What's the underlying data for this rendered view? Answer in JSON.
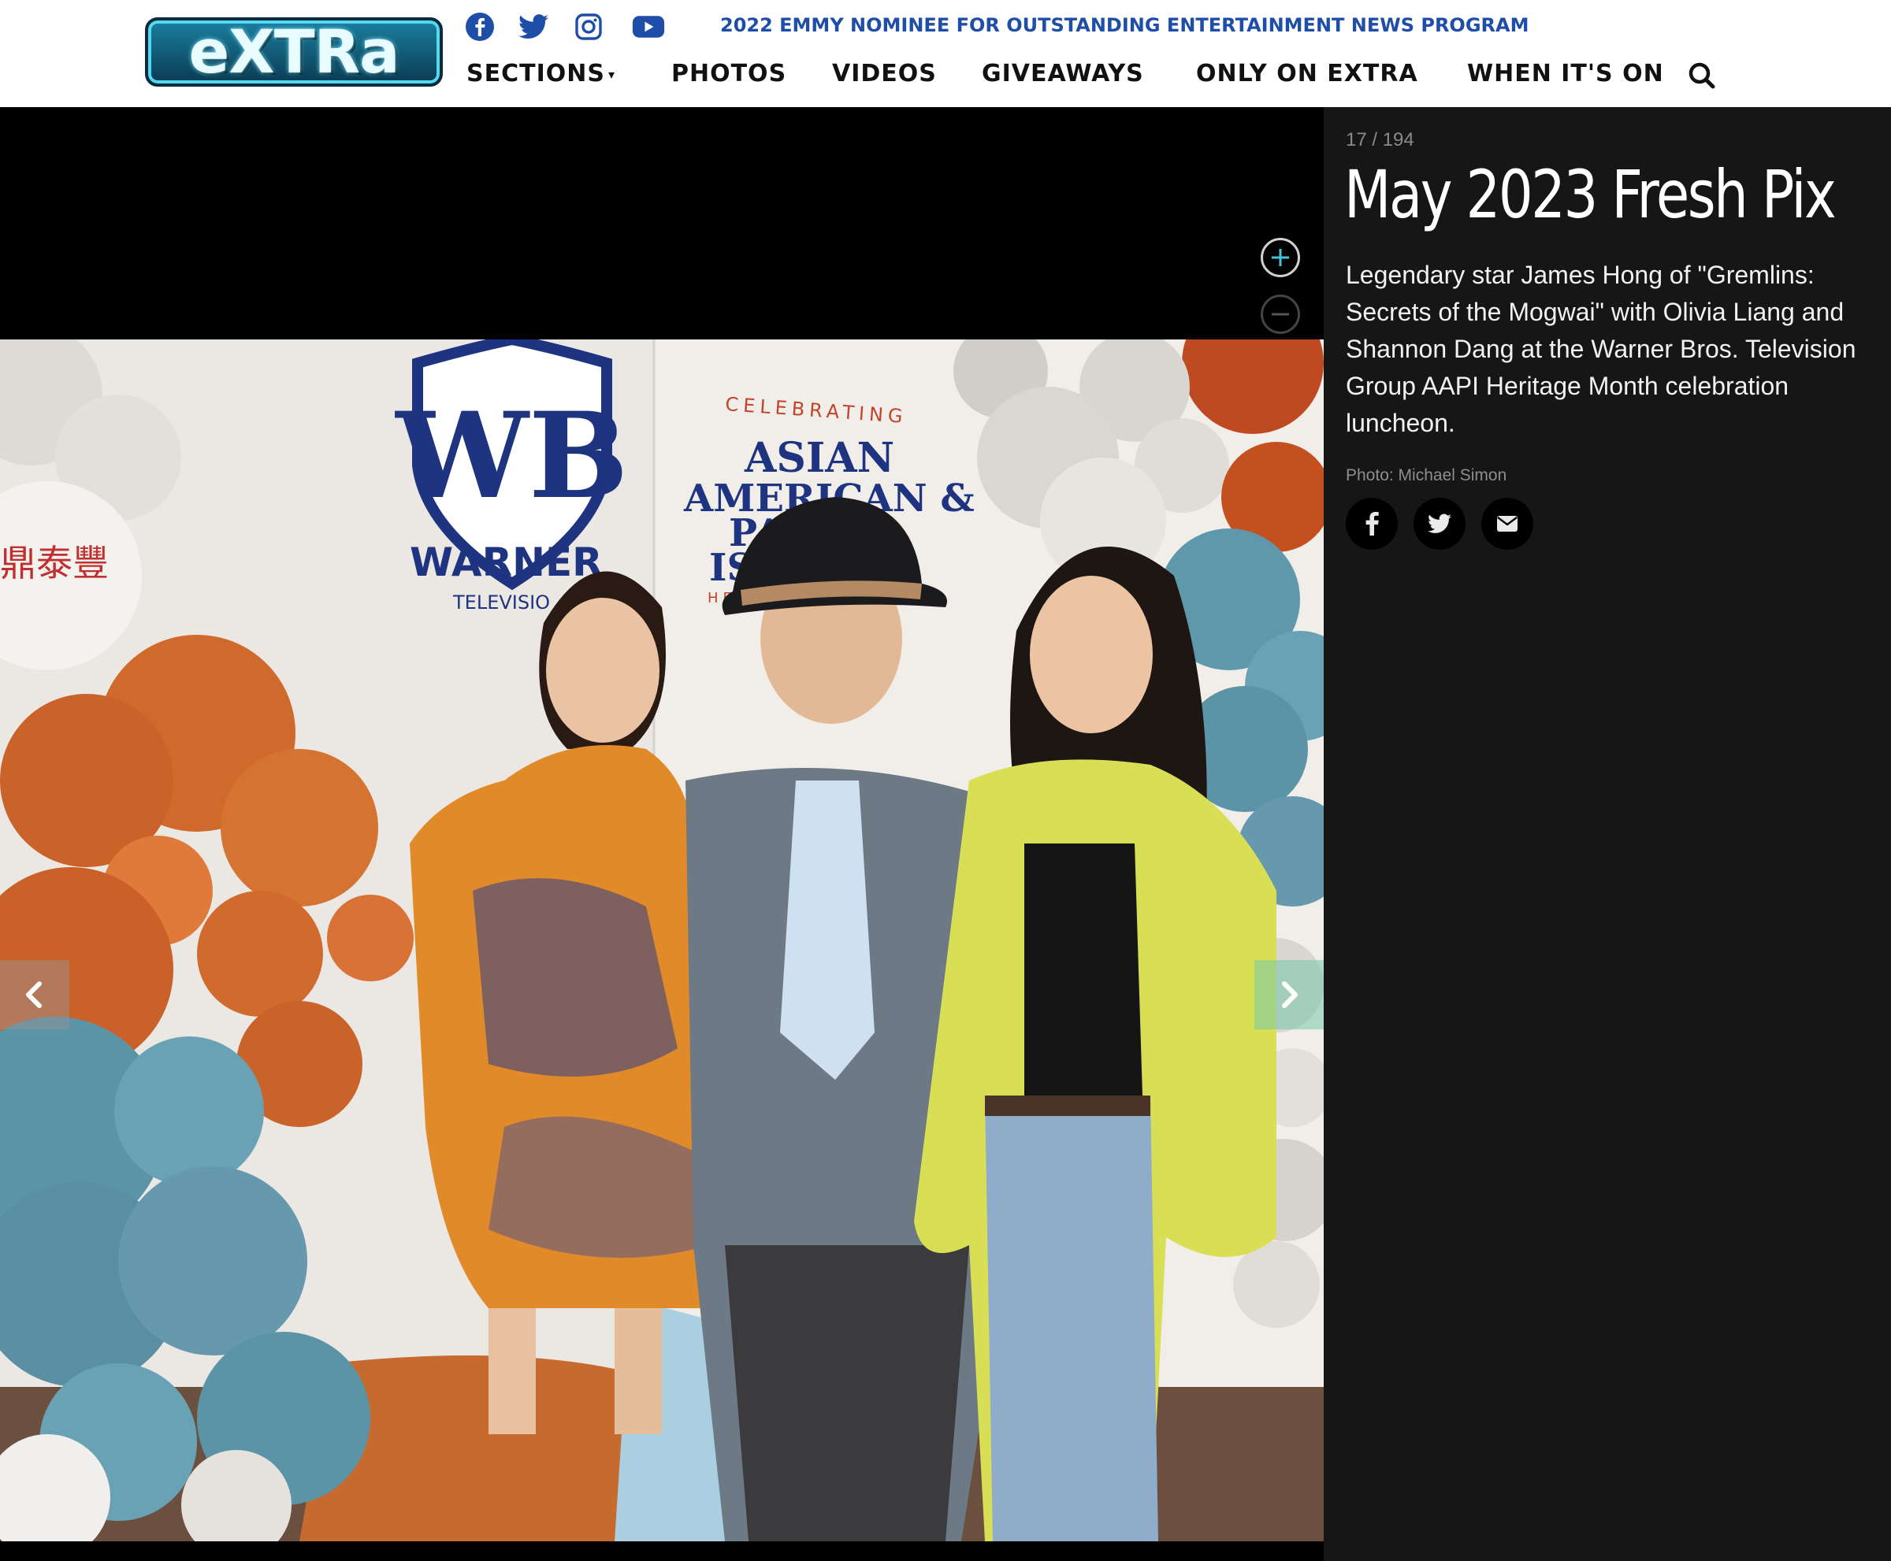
{
  "header": {
    "logo_text": "eXTRa",
    "tagline": "2022 EMMY NOMINEE FOR OUTSTANDING ENTERTAINMENT NEWS PROGRAM",
    "social": [
      "facebook-icon",
      "twitter-icon",
      "instagram-icon",
      "youtube-icon"
    ],
    "nav": [
      {
        "label": "SECTIONS",
        "has_dropdown": true
      },
      {
        "label": "PHOTOS"
      },
      {
        "label": "VIDEOS"
      },
      {
        "label": "GIVEAWAYS"
      },
      {
        "label": "ONLY ON EXTRA"
      },
      {
        "label": "WHEN IT'S ON"
      }
    ]
  },
  "photo": {
    "backdrop_brand": "WB",
    "backdrop_name": "WARNER",
    "backdrop_sub": "TELEVISIO",
    "banner_small": "CELEBRATING",
    "banner_line1": "ASIAN",
    "banner_line2": "AMERICAN &",
    "banner_line3": "PA",
    "banner_line4": "ISL",
    "banner_line5": "HE",
    "balloon_text": "鼎泰豐"
  },
  "gallery": {
    "counter": "17 / 194",
    "title": "May 2023 Fresh Pix",
    "caption": "Legendary star James Hong of \"Gremlins: Secrets of the Mogwai\" with Olivia Liang and Shannon Dang at the Warner Bros. Television Group AAPI Heritage Month celebration luncheon.",
    "credit": "Photo: Michael Simon",
    "share": [
      "facebook-icon",
      "twitter-icon",
      "email-icon"
    ]
  },
  "colors": {
    "tagline": "#1f4ea8",
    "sidebar_bg": "#161616",
    "accent_teal": "#3fc6d8",
    "balloon_orange": "#d2692a",
    "balloon_blue": "#5a93a8",
    "balloon_gray": "#d6d3cf"
  }
}
